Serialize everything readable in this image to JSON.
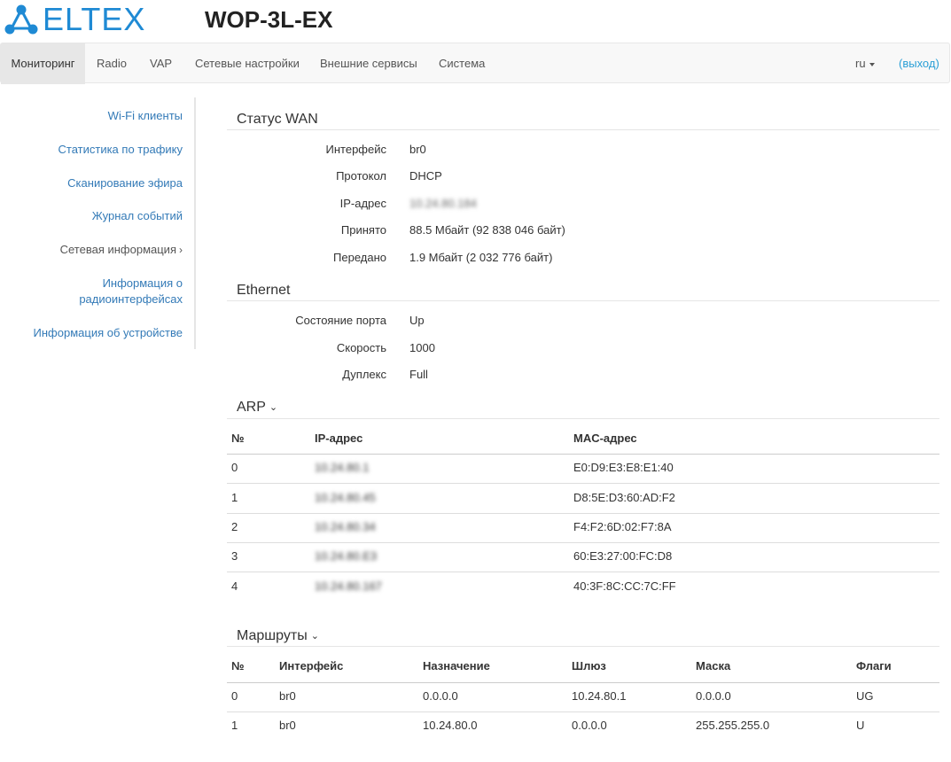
{
  "brand": {
    "logo_text": "ELTEX",
    "model": "WOP-3L-EX",
    "logo_color": "#1f8ad4"
  },
  "nav": {
    "items": [
      "Мониторинг",
      "Radio",
      "VAP",
      "Сетевые настройки",
      "Внешние сервисы",
      "Система"
    ],
    "lang": "ru",
    "logout": "(выход)"
  },
  "sidebar": {
    "items": [
      "Wi-Fi клиенты",
      "Статистика по трафику",
      "Сканирование эфира",
      "Журнал событий",
      "Сетевая информация",
      "Информация о",
      "радиоинтерфейсах",
      "Информация об устройстве"
    ]
  },
  "wan": {
    "title": "Статус WAN",
    "rows": [
      {
        "label": "Интерфейс",
        "value": "br0"
      },
      {
        "label": "Протокол",
        "value": "DHCP"
      },
      {
        "label": "IP-адрес",
        "value": "10.24.80.184"
      },
      {
        "label": "Принято",
        "value": "88.5 Мбайт (92 838 046 байт)"
      },
      {
        "label": "Передано",
        "value": "1.9 Мбайт (2 032 776 байт)"
      }
    ]
  },
  "ethernet": {
    "title": "Ethernet",
    "rows": [
      {
        "label": "Состояние порта",
        "value": "Up"
      },
      {
        "label": "Скорость",
        "value": "1000"
      },
      {
        "label": "Дуплекс",
        "value": "Full"
      }
    ]
  },
  "arp": {
    "title": "ARP",
    "columns": [
      "№",
      "IP-адрес",
      "MAC-адрес"
    ],
    "rows": [
      [
        "0",
        "10.24.80.1",
        "E0:D9:E3:E8:E1:40"
      ],
      [
        "1",
        "10.24.80.45",
        "D8:5E:D3:60:AD:F2"
      ],
      [
        "2",
        "10.24.80.34",
        "F4:F2:6D:02:F7:8A"
      ],
      [
        "3",
        "10.24.80.E3",
        "60:E3:27:00:FC:D8"
      ],
      [
        "4",
        "10.24.80.167",
        "40:3F:8C:CC:7C:FF"
      ]
    ]
  },
  "routes": {
    "title": "Маршруты",
    "columns": [
      "№",
      "Интерфейс",
      "Назначение",
      "Шлюз",
      "Маска",
      "Флаги"
    ],
    "rows": [
      [
        "0",
        "br0",
        "0.0.0.0",
        "10.24.80.1",
        "0.0.0.0",
        "UG"
      ],
      [
        "1",
        "br0",
        "10.24.80.0",
        "0.0.0.0",
        "255.255.255.0",
        "U"
      ]
    ]
  }
}
